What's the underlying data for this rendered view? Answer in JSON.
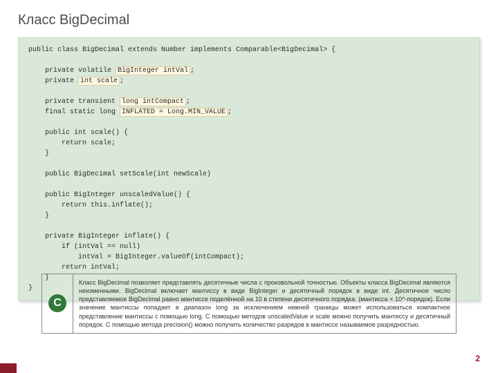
{
  "title": "Класс BigDecimal",
  "code": {
    "l01": "public class BigDecimal extends Number implements Comparable<BigDecimal> {",
    "l02": "",
    "l03a": "    private volatile ",
    "l03b": "BigInteger intVal",
    "l03c": ";",
    "l04a": "    private ",
    "l04b": "int scale",
    "l04c": ";",
    "l05": "",
    "l06a": "    private transient ",
    "l06b": "long intCompact",
    "l06c": ";",
    "l07a": "    final static long ",
    "l07b": "INFLATED = Long.MIN_VALUE",
    "l07c": ";",
    "l08": "",
    "l09": "    public int scale() {",
    "l10": "        return scale;",
    "l11": "    }",
    "l12": "",
    "l13": "    public BigDecimal setScale(int newScale)",
    "l14": "",
    "l15": "    public BigInteger unscaledValue() {",
    "l16": "        return this.inflate();",
    "l17": "    }",
    "l18": "",
    "l19": "    private BigInteger inflate() {",
    "l20": "        if (intVal == null)",
    "l21": "            intVal = BigInteger.valueOf(intCompact);",
    "l22": "        return intVal;",
    "l23": "    }",
    "l24": "}"
  },
  "badge_letter": "C",
  "description": "Класс BigDecimal позволяет представлять десятичные числа с произвольной точностью. Объекты класса BigDecimal являются неизменными. BigDecimal включает мантиссу в виде BigInteger и десятичный порядок в виде int. Десятичное число представляемое BigDecimal равно мантиссе поделённой на 10 в степени десятичного порядка. (мантисса × 10^-порядок). Если значение мантиссы попадает в диапазон long за исключением нижней границы может использоваться компактное представление мантиссы с помощью long. С помощью методов unscaledValue и scale можно получить мантиссу и десятичный порядок. С помощью метода precision() можно получить количество разрядов в мантиссе называемое разрядностью.",
  "page_number": "2"
}
